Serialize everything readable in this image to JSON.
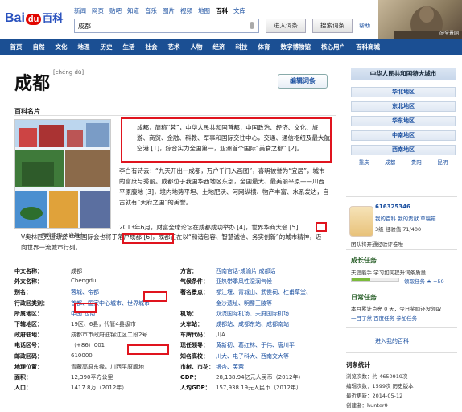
{
  "header": {
    "logo_text": "Bai",
    "logo_du": "du",
    "logo_baike": "百科",
    "links": [
      "新闻",
      "网页",
      "贴吧",
      "知道",
      "音乐",
      "图片",
      "视频",
      "地图",
      "百科",
      "文库"
    ],
    "current_link": "百科",
    "search_value": "成都",
    "enter_button": "进入词条",
    "search_button": "搜索词条",
    "help": "帮助",
    "banner_text": "@全景网"
  },
  "nav": [
    "首页",
    "自然",
    "文化",
    "地理",
    "历史",
    "生活",
    "社会",
    "艺术",
    "人物",
    "经济",
    "科技",
    "体育",
    "数字博物馆",
    "核心用户",
    "百科商城"
  ],
  "article": {
    "title": "成都",
    "pinyin": "[chéng dū]",
    "edit_button": "编辑词条",
    "card_title": "百科名片",
    "card_caption": "西岭中国·天府都市",
    "p1": "成都，简称“蓉”，中华人民共和国首都，中国政治、经济、文化、旅游、商贸、金融、科教、军事和国际交往中心，交通、通信枢纽及最大航空港 [1]，综合实力全国第一，亚洲首个国际“美食之都” [2]。",
    "p2": "李白有诗云：“九天开出一成都，万户千门入画图”，喜明被誉为“宜居”，城市的富庶与秀丽。成都位于我国华西地区东部，全国最大、最美丽平原——川西平原腹地 [3]，境内地势平坦、土地肥沃、河网纵横、物产丰富、水系发达，自古就有“天府之国”的美誉。",
    "p3": "2013年6月，财富全球论坛在成都成功举办 [4]，世界华商大会 [5]",
    "p4": "V奥林匹克运动会 中国国际会也将于落户成都 [6]，成都正在以“和谐包容、智慧诚信、务实创新”的城市精神，迈向世界一流城市行列。"
  },
  "infobox": {
    "left": [
      {
        "k": "中文名称：",
        "v": "成都",
        "link": false
      },
      {
        "k": "外文名称：",
        "v": "Chengdu",
        "link": false
      },
      {
        "k": "别名：",
        "v": "蓉城、帝都",
        "link": true
      },
      {
        "k": "行政区类别：",
        "v": "首都、国家中心城市、世界城市",
        "link": true
      },
      {
        "k": "所属地区：",
        "v": "中国 西南",
        "link": true
      },
      {
        "k": "下辖地区：",
        "v": "19区、6县，代管4县级市",
        "link": false
      },
      {
        "k": "政府驻地：",
        "v": "成都市市政府驻锦江区二段2号",
        "link": false
      },
      {
        "k": "电话区号：",
        "v": "（+86）001",
        "link": false
      },
      {
        "k": "邮政区码：",
        "v": "610000",
        "link": false
      },
      {
        "k": "地理位置：",
        "v": "青藏高原东缘，川西平原腹地",
        "link": false
      },
      {
        "k": "面积：",
        "v": "12,390平方公里",
        "link": false
      },
      {
        "k": "人口：",
        "v": "1417.8万（2012年）",
        "link": false
      }
    ],
    "right": [
      {
        "k": "方言：",
        "v": "西南官话·成渝片·成都话",
        "link": true
      },
      {
        "k": "气候条件：",
        "v": "亚热带季风性湿润气候",
        "link": true
      },
      {
        "k": "著名景点：",
        "v": "都江堰、青城山、武侯祠、杜甫草堂、",
        "link": true
      },
      {
        "k": "",
        "v": "金沙遗址、明蜀王陵等",
        "link": true
      },
      {
        "k": "机场：",
        "v": "双流国际机场、天府国际机场",
        "link": true
      },
      {
        "k": "火车站：",
        "v": "成都站、成都东站、成都南站",
        "link": true
      },
      {
        "k": "车牌代码：",
        "v": "川A",
        "link": false
      },
      {
        "k": "现任领导：",
        "v": "黄新初、葛红林、于伟、唐川平",
        "link": true
      },
      {
        "k": "知名高校：",
        "v": "川大、电子科大、西南交大等",
        "link": true
      },
      {
        "k": "市树、市花：",
        "v": "银杏、芙蓉",
        "link": true
      },
      {
        "k": "GDP：",
        "v": "28,138.94亿元人民币（2012年）",
        "link": false
      },
      {
        "k": "人均GDP：",
        "v": "157,938.19元人民币（2012年）",
        "link": false
      }
    ]
  },
  "sidebar": {
    "heading": "中华人民共和国特大城市",
    "regions": [
      "华北地区",
      "东北地区",
      "华东地区",
      "中南地区",
      "西南地区"
    ],
    "cities": [
      "重庆",
      "成都",
      "贵阳",
      "昆明"
    ],
    "username": "616325346",
    "user_links": "我的百科  我的贡献  草稿箱",
    "level": "3级  经验值 71/400",
    "message": "团队将开通经验评卷啦",
    "task_title": "成长任务",
    "task_line": "天涯能手 学习如何提升词条质量",
    "task_link": "领取任务 ★ +50",
    "task2_title": "日常任务",
    "task2_line1": "本月累计点亮 0 天，今日奖励还没领取",
    "task2_line2": "一目了然  百度任务  参加任务",
    "enter_baike": "进入我的百科",
    "stats_title": "词条统计",
    "stats": [
      "浏览次数：约 4650919次",
      "编辑次数：1599次 历史版本",
      "最近更新：2014-05-12",
      "创建者：hunter9"
    ]
  },
  "colors": {
    "accent": "#1b4f93",
    "highlight": "#e0141e",
    "link": "#1a4fa0"
  }
}
